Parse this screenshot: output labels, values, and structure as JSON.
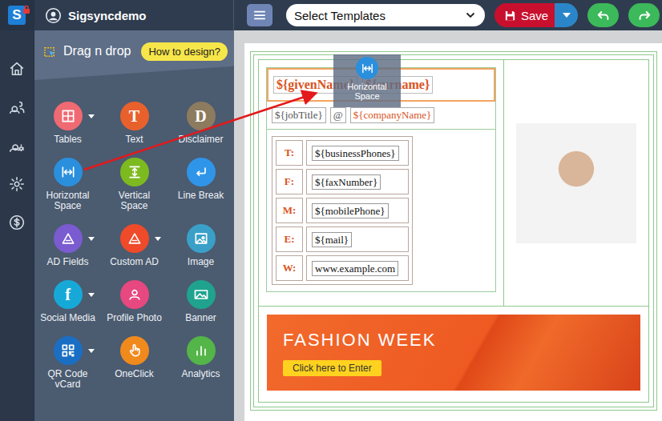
{
  "logo": "S",
  "account": {
    "name": "Sigsyncdemo"
  },
  "palette": {
    "title": "Drag n drop",
    "help": "How to design?",
    "tools": [
      {
        "label": "Tables",
        "menu": true,
        "color": "#ef6a72"
      },
      {
        "label": "Text",
        "menu": false,
        "color": "#e8612c",
        "glyph": "T"
      },
      {
        "label": "Disclaimer",
        "menu": false,
        "color": "#8d7b5f",
        "glyph": "D"
      },
      {
        "label": "Horizontal Space",
        "menu": false,
        "color": "#2a8fdd"
      },
      {
        "label": "Vertical Space",
        "menu": false,
        "color": "#7dba1f"
      },
      {
        "label": "Line Break",
        "menu": false,
        "color": "#2f95e8"
      },
      {
        "label": "AD Fields",
        "menu": true,
        "color": "#7a5bd0"
      },
      {
        "label": "Custom AD",
        "menu": true,
        "color": "#ef4a2a"
      },
      {
        "label": "Image",
        "menu": false,
        "color": "#3aa0c8"
      },
      {
        "label": "Social Media",
        "menu": true,
        "color": "#16a9d8",
        "glyph": "f"
      },
      {
        "label": "Profile Photo",
        "menu": false,
        "color": "#e6487f"
      },
      {
        "label": "Banner",
        "menu": false,
        "color": "#1fa38f"
      },
      {
        "label": "QR Code vCard",
        "menu": true,
        "color": "#1a6fc4"
      },
      {
        "label": "OneClick",
        "menu": false,
        "color": "#f08a1d"
      },
      {
        "label": "Analytics",
        "menu": false,
        "color": "#54b548"
      }
    ]
  },
  "toolbar": {
    "template_placeholder": "Select Templates",
    "save": "Save"
  },
  "signature": {
    "name_row_highlighted": true,
    "name_fields": [
      "${givenName}",
      "${surname}"
    ],
    "title_fields": [
      {
        "text": "${jobTitle}",
        "color": "#555555"
      },
      {
        "text": "@",
        "color": "#555555"
      },
      {
        "text": "${companyName}",
        "color": "#d9531e"
      }
    ],
    "contacts": [
      {
        "label": "T:",
        "value": "${businessPhones}"
      },
      {
        "label": "F:",
        "value": "${faxNumber}"
      },
      {
        "label": "M:",
        "value": "${mobilePhone}"
      },
      {
        "label": "E:",
        "value": "${mail}"
      },
      {
        "label": "W:",
        "value": "www.example.com"
      }
    ],
    "banner": {
      "title": "FASHION WEEK",
      "cta": "Click here to Enter"
    }
  },
  "drag_ghost": {
    "label": "Horizontal Space"
  }
}
